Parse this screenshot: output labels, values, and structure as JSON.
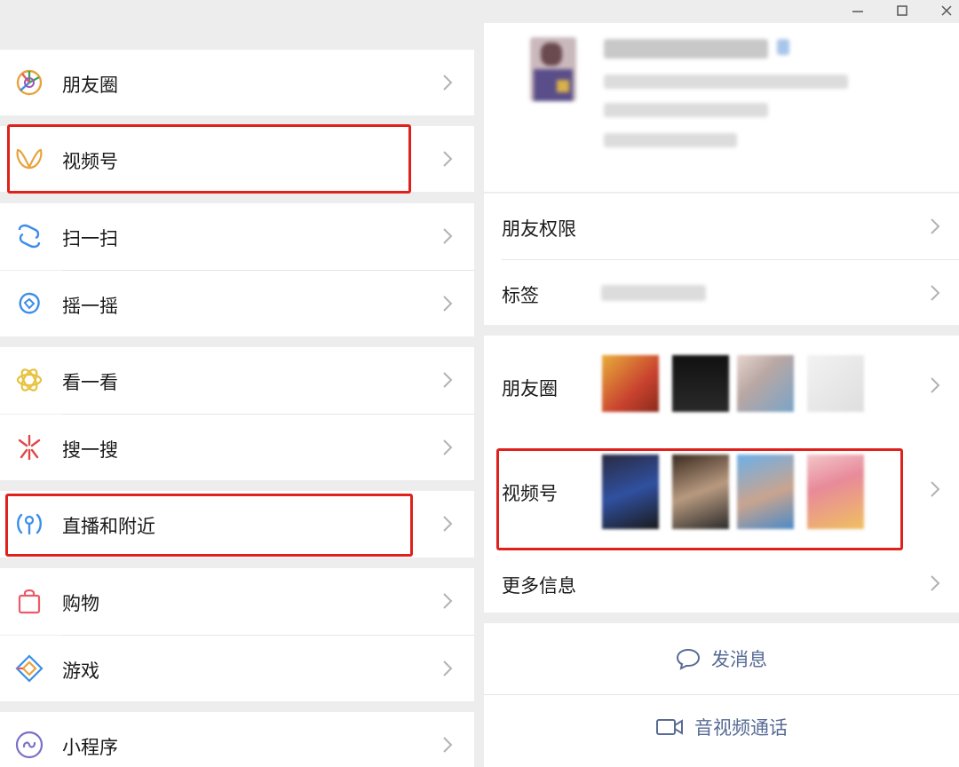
{
  "left_menu": {
    "items": [
      {
        "label": "朋友圈",
        "icon": "moments-icon"
      },
      {
        "label": "视频号",
        "icon": "channels-icon"
      },
      {
        "label": "扫一扫",
        "icon": "scan-icon"
      },
      {
        "label": "摇一摇",
        "icon": "shake-icon"
      },
      {
        "label": "看一看",
        "icon": "top-stories-icon"
      },
      {
        "label": "搜一搜",
        "icon": "search-icon"
      },
      {
        "label": "直播和附近",
        "icon": "live-nearby-icon"
      },
      {
        "label": "购物",
        "icon": "shopping-bag-icon"
      },
      {
        "label": "游戏",
        "icon": "games-icon"
      },
      {
        "label": "小程序",
        "icon": "mini-programs-icon"
      }
    ]
  },
  "profile": {
    "rows": {
      "friend_permissions": "朋友权限",
      "tags": "标签",
      "moments": "朋友圈",
      "channels": "视频号",
      "more_info": "更多信息"
    },
    "actions": {
      "send_message": "发消息",
      "video_call": "音视频通话"
    }
  },
  "colors": {
    "highlight": "#e0201b",
    "link": "#576b95",
    "background": "#ededed"
  }
}
